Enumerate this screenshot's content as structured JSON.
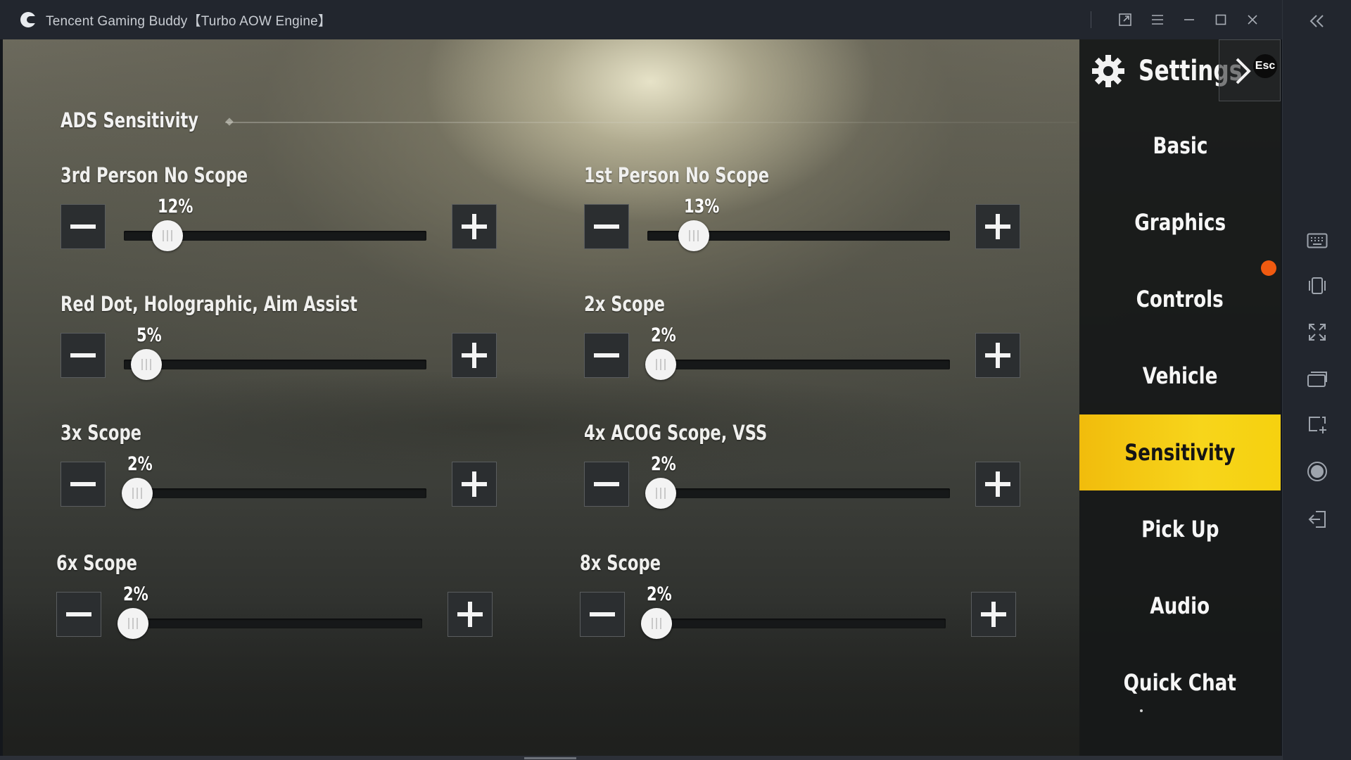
{
  "window": {
    "title": "Tencent Gaming Buddy【Turbo AOW Engine】"
  },
  "section": {
    "title": "ADS Sensitivity"
  },
  "sliders": [
    {
      "label": "3rd Person No Scope",
      "value": "12%",
      "fraction": 0.12
    },
    {
      "label": "1st Person No Scope",
      "value": "13%",
      "fraction": 0.13
    },
    {
      "label": "Red Dot, Holographic, Aim Assist",
      "value": "5%",
      "fraction": 0.05
    },
    {
      "label": "2x Scope",
      "value": "2%",
      "fraction": 0.02
    },
    {
      "label": "3x Scope",
      "value": "2%",
      "fraction": 0.02
    },
    {
      "label": "4x ACOG Scope, VSS",
      "value": "2%",
      "fraction": 0.02
    },
    {
      "label": "6x Scope",
      "value": "2%",
      "fraction": 0.02
    },
    {
      "label": "8x Scope",
      "value": "2%",
      "fraction": 0.02
    }
  ],
  "menu": {
    "title": "Settings",
    "close_hint": "Esc",
    "items": [
      {
        "label": "Basic"
      },
      {
        "label": "Graphics"
      },
      {
        "label": "Controls"
      },
      {
        "label": "Vehicle"
      },
      {
        "label": "Sensitivity",
        "active": true
      },
      {
        "label": "Pick Up"
      },
      {
        "label": "Audio"
      },
      {
        "label": "Quick Chat"
      }
    ]
  },
  "colors": {
    "active_menu": "#f5cc12",
    "notification": "#f05a10",
    "titlebar": "#22262e"
  },
  "icons": {
    "titlebar": [
      "restore-window-icon",
      "menu-icon",
      "minimize-icon",
      "maximize-icon",
      "close-icon"
    ],
    "side_toolbar": [
      "collapse-icon",
      "keyboard-icon",
      "shake-icon",
      "fullscreen-icon",
      "multi-window-icon",
      "screenshot-add-icon",
      "record-icon",
      "exit-icon"
    ]
  }
}
